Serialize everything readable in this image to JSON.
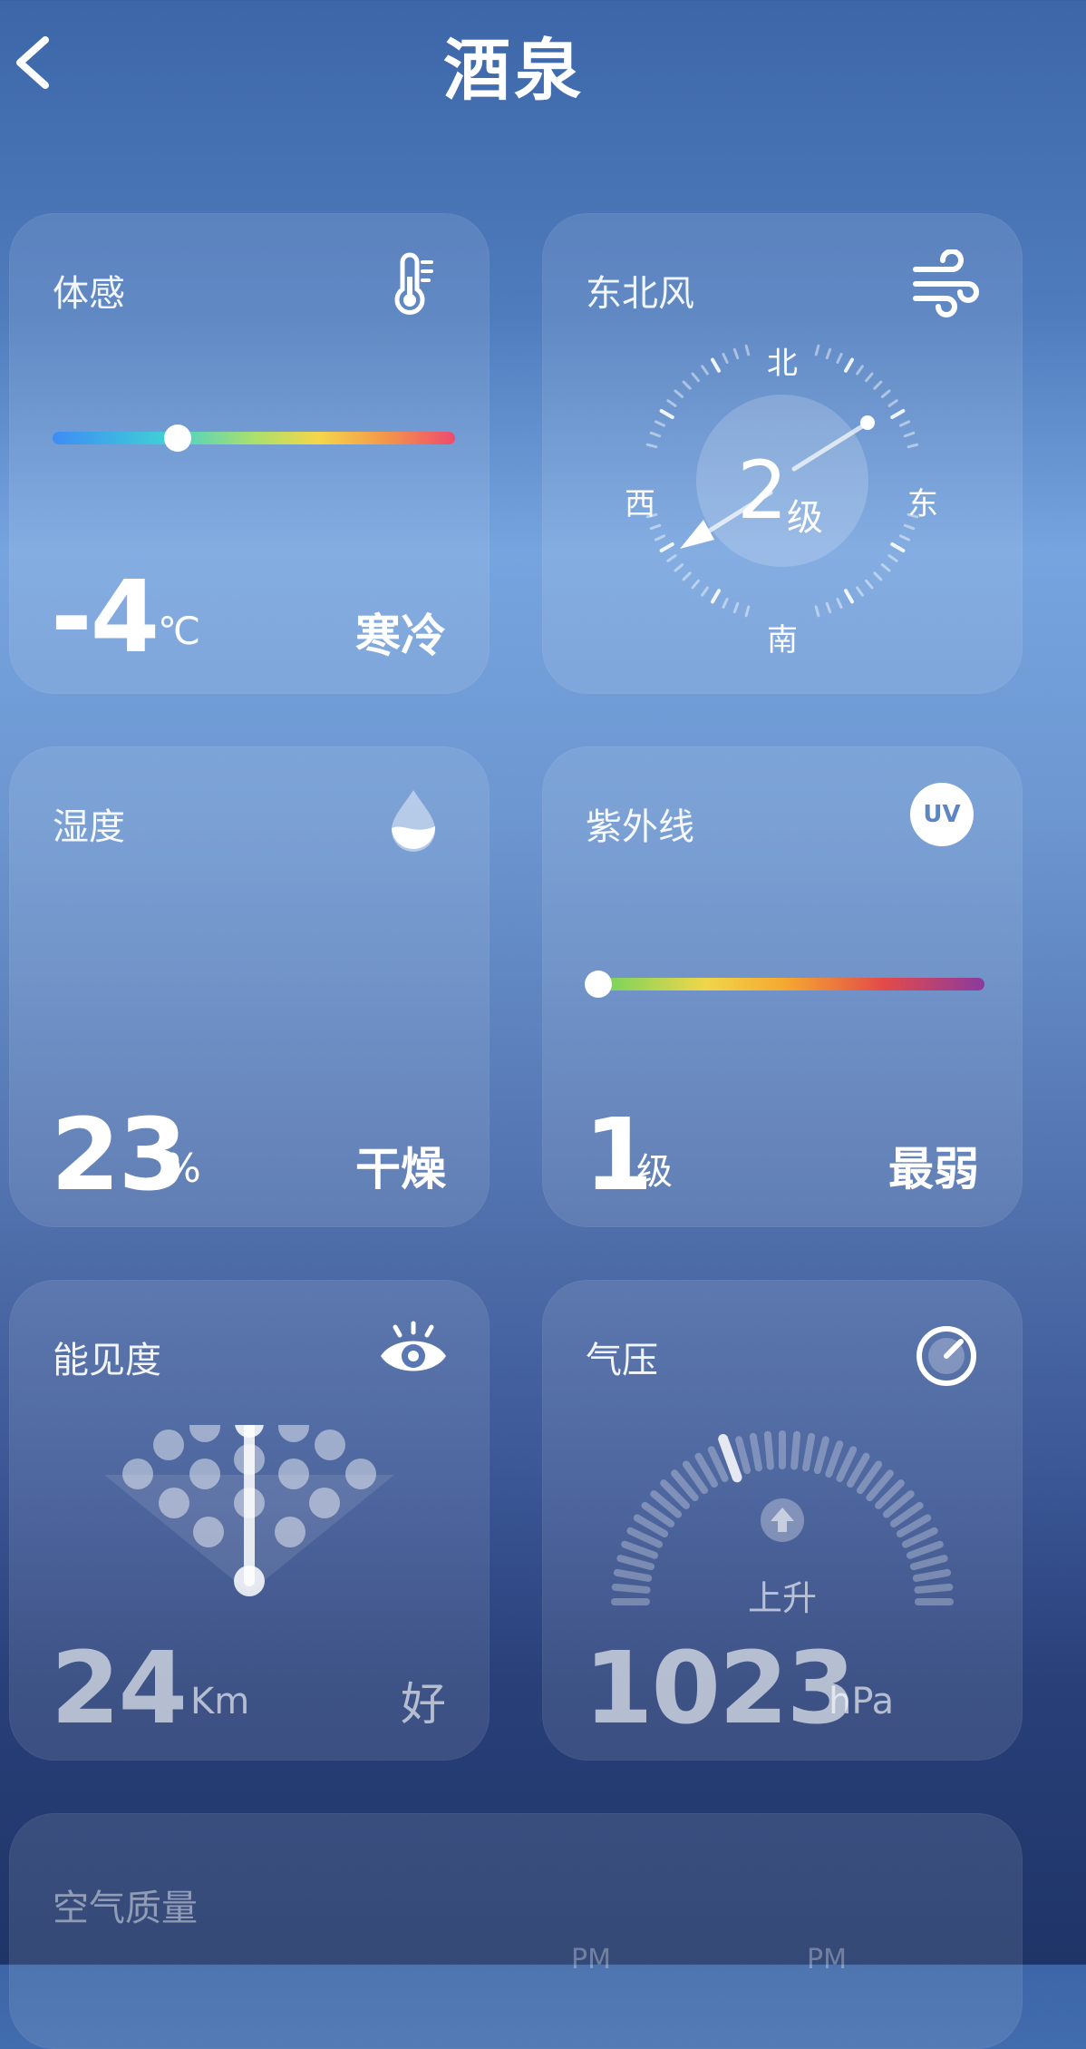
{
  "header": {
    "title": "酒泉"
  },
  "feels_like": {
    "title": "体感",
    "value": "-4",
    "unit": "℃",
    "desc": "寒冷",
    "level": 0.3
  },
  "wind": {
    "title": "东北风",
    "level": "2",
    "level_unit": "级",
    "north": "北",
    "south": "南",
    "east": "东",
    "west": "西"
  },
  "humidity": {
    "title": "湿度",
    "value": "23",
    "unit": "%",
    "desc": "干燥"
  },
  "uv": {
    "title": "紫外线",
    "icon_text": "UV",
    "value": "1",
    "unit": "级",
    "desc": "最弱",
    "level": 0.0
  },
  "visibility": {
    "title": "能见度",
    "value": "24",
    "unit": "Km",
    "desc": "好"
  },
  "pressure": {
    "title": "气压",
    "trend": "上升",
    "value": "1023",
    "unit": "hPa"
  },
  "air_quality": {
    "title": "空气质量",
    "labels": [
      "PM",
      "PM"
    ]
  },
  "colors": {
    "accent_white": "#ffffff"
  }
}
